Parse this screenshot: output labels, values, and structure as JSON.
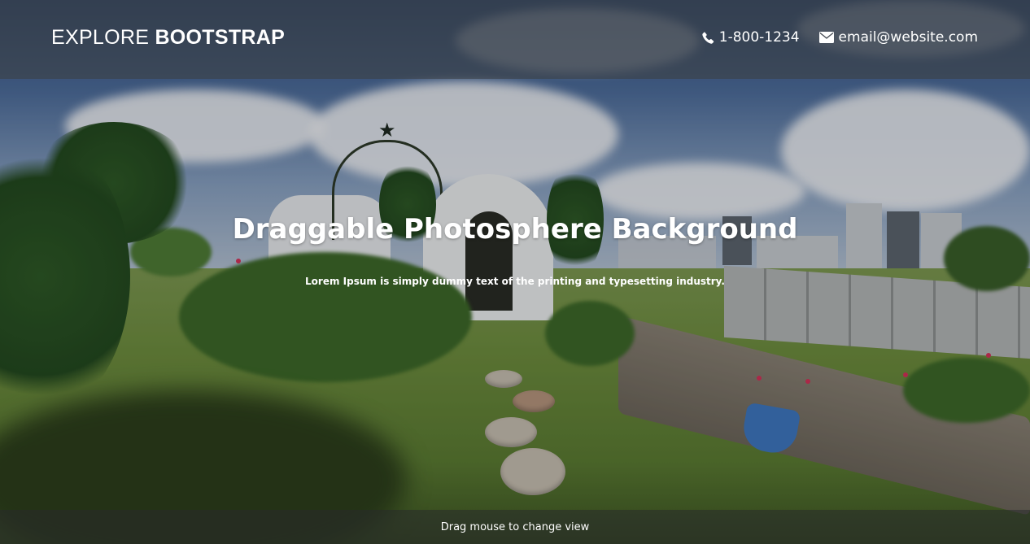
{
  "navbar": {
    "brand_light": "EXPLORE",
    "brand_bold": "BOOTSTRAP",
    "phone": "1-800-1234",
    "email": "email@website.com",
    "phone_icon": "phone-icon",
    "email_icon": "envelope-icon"
  },
  "hero": {
    "title": "Draggable Photosphere Background",
    "subtitle": "Lorem Ipsum is simply dummy text of the printing and typesetting industry."
  },
  "footer": {
    "hint": "Drag mouse to change view"
  },
  "colors": {
    "navbar_bg": "#3c4046",
    "text": "#ffffff",
    "footer_bg": "#282a2c"
  }
}
